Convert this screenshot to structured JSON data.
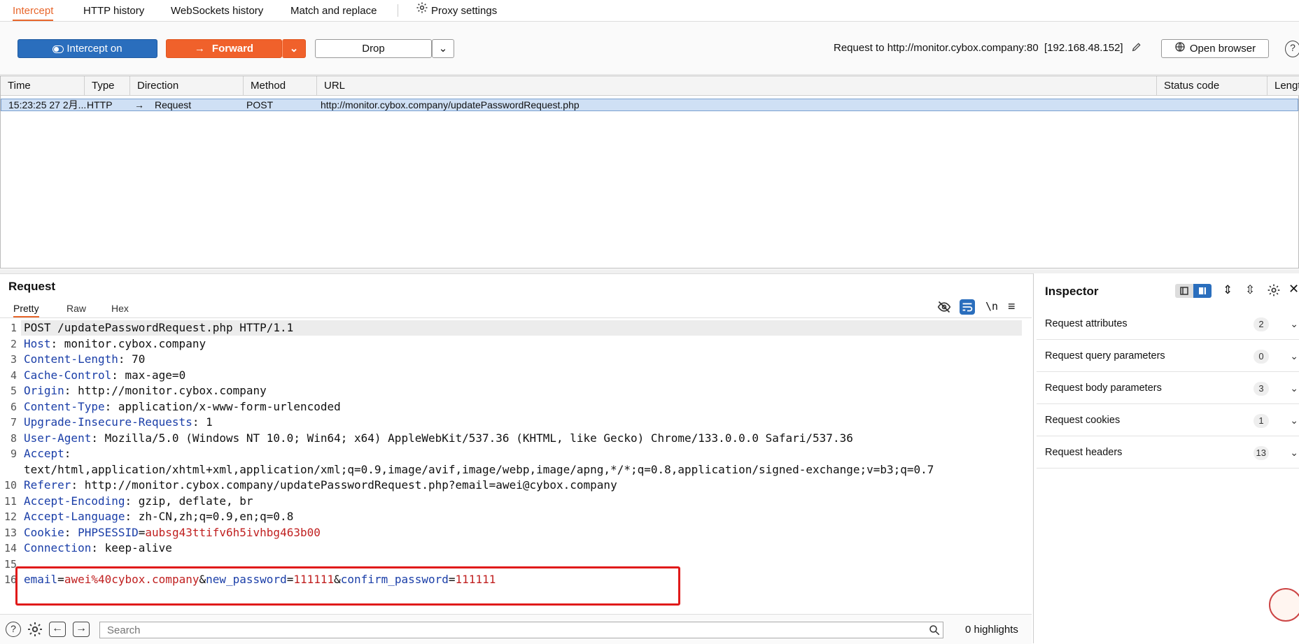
{
  "tabs": [
    "Intercept",
    "HTTP history",
    "WebSockets history",
    "Match and replace",
    "Proxy settings"
  ],
  "toolbar": {
    "intercept_label": "Intercept on",
    "forward_label": "Forward",
    "drop_label": "Drop",
    "request_target": "Request to http://monitor.cybox.company:80  [192.168.48.152]",
    "open_browser_label": "Open browser"
  },
  "table": {
    "columns": [
      "Time",
      "Type",
      "Direction",
      "Method",
      "URL",
      "Status code",
      "Length"
    ],
    "rows": [
      {
        "time": "15:23:25 27 2月...",
        "type": "HTTP",
        "direction": "Request",
        "method": "POST",
        "url": "http://monitor.cybox.company/updatePasswordRequest.php",
        "status": "",
        "length": ""
      }
    ]
  },
  "request": {
    "title": "Request",
    "subtabs": [
      "Pretty",
      "Raw",
      "Hex"
    ],
    "lines": [
      {
        "n": "1",
        "parts": [
          {
            "t": "POST /updatePasswordRequest.php HTTP/1.1",
            "c": "plain"
          }
        ]
      },
      {
        "n": "2",
        "parts": [
          {
            "t": "Host",
            "c": "hk"
          },
          {
            "t": ": monitor.cybox.company",
            "c": "plain"
          }
        ]
      },
      {
        "n": "3",
        "parts": [
          {
            "t": "Content-Length",
            "c": "hk"
          },
          {
            "t": ": 70",
            "c": "plain"
          }
        ]
      },
      {
        "n": "4",
        "parts": [
          {
            "t": "Cache-Control",
            "c": "hk"
          },
          {
            "t": ": max-age=0",
            "c": "plain"
          }
        ]
      },
      {
        "n": "5",
        "parts": [
          {
            "t": "Origin",
            "c": "hk"
          },
          {
            "t": ": http://monitor.cybox.company",
            "c": "plain"
          }
        ]
      },
      {
        "n": "6",
        "parts": [
          {
            "t": "Content-Type",
            "c": "hk"
          },
          {
            "t": ": application/x-www-form-urlencoded",
            "c": "plain"
          }
        ]
      },
      {
        "n": "7",
        "parts": [
          {
            "t": "Upgrade-Insecure-Requests",
            "c": "hk"
          },
          {
            "t": ": 1",
            "c": "plain"
          }
        ]
      },
      {
        "n": "8",
        "parts": [
          {
            "t": "User-Agent",
            "c": "hk"
          },
          {
            "t": ": Mozilla/5.0 (Windows NT 10.0; Win64; x64) AppleWebKit/537.36 (KHTML, like Gecko) Chrome/133.0.0.0 Safari/537.36",
            "c": "plain"
          }
        ]
      },
      {
        "n": "9",
        "parts": [
          {
            "t": "Accept",
            "c": "hk"
          },
          {
            "t": ":",
            "c": "plain"
          }
        ]
      },
      {
        "n": "",
        "parts": [
          {
            "t": "text/html,application/xhtml+xml,application/xml;q=0.9,image/avif,image/webp,image/apng,*/*;q=0.8,application/signed-exchange;v=b3;q=0.7",
            "c": "plain"
          }
        ]
      },
      {
        "n": "10",
        "parts": [
          {
            "t": "Referer",
            "c": "hk"
          },
          {
            "t": ": http://monitor.cybox.company/updatePasswordRequest.php?email=awei@cybox.company",
            "c": "plain"
          }
        ]
      },
      {
        "n": "11",
        "parts": [
          {
            "t": "Accept-Encoding",
            "c": "hk"
          },
          {
            "t": ": gzip, deflate, br",
            "c": "plain"
          }
        ]
      },
      {
        "n": "12",
        "parts": [
          {
            "t": "Accept-Language",
            "c": "hk"
          },
          {
            "t": ": zh-CN,zh;q=0.9,en;q=0.8",
            "c": "plain"
          }
        ]
      },
      {
        "n": "13",
        "parts": [
          {
            "t": "Cookie",
            "c": "hk"
          },
          {
            "t": ": ",
            "c": "plain"
          },
          {
            "t": "PHPSESSID",
            "c": "ck"
          },
          {
            "t": "=",
            "c": "plain"
          },
          {
            "t": "aubsg43ttifv6h5ivhbg463b00",
            "c": "cv"
          }
        ]
      },
      {
        "n": "14",
        "parts": [
          {
            "t": "Connection",
            "c": "hk"
          },
          {
            "t": ": keep-alive",
            "c": "plain"
          }
        ]
      },
      {
        "n": "15",
        "parts": []
      },
      {
        "n": "16",
        "parts": [
          {
            "t": "email",
            "c": "ck"
          },
          {
            "t": "=",
            "c": "plain"
          },
          {
            "t": "awei%40cybox.company",
            "c": "cv"
          },
          {
            "t": "&",
            "c": "plain"
          },
          {
            "t": "new_password",
            "c": "ck"
          },
          {
            "t": "=",
            "c": "plain"
          },
          {
            "t": "111111",
            "c": "cv"
          },
          {
            "t": "&",
            "c": "plain"
          },
          {
            "t": "confirm_password",
            "c": "ck"
          },
          {
            "t": "=",
            "c": "plain"
          },
          {
            "t": "111111",
            "c": "cv"
          }
        ]
      }
    ]
  },
  "bottom": {
    "search_placeholder": "Search",
    "highlights": "0 highlights"
  },
  "inspector": {
    "title": "Inspector",
    "items": [
      {
        "label": "Request attributes",
        "count": "2"
      },
      {
        "label": "Request query parameters",
        "count": "0"
      },
      {
        "label": "Request body parameters",
        "count": "3"
      },
      {
        "label": "Request cookies",
        "count": "1"
      },
      {
        "label": "Request headers",
        "count": "13"
      }
    ]
  },
  "colors": {
    "accent": "#e8662b",
    "intercept": "#2a6ebd",
    "forward": "#f0612b",
    "highlight_border": "#e01a1a"
  }
}
